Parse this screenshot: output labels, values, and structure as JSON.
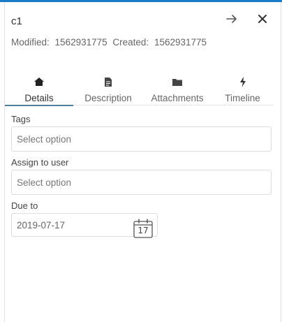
{
  "card": {
    "title": "c1",
    "modified_label": "Modified:",
    "modified_value": "1562931775",
    "created_label": "Created:",
    "created_value": "1562931775"
  },
  "header": {
    "icons": [
      "arrow-right-icon",
      "close-icon"
    ]
  },
  "tabs": [
    {
      "label": "Details",
      "icon": "home-icon",
      "active": true
    },
    {
      "label": "Description",
      "icon": "document-icon",
      "active": false
    },
    {
      "label": "Attachments",
      "icon": "folder-icon",
      "active": false
    },
    {
      "label": "Timeline",
      "icon": "lightning-icon",
      "active": false
    }
  ],
  "form": {
    "tags": {
      "label": "Tags",
      "placeholder": "Select option"
    },
    "assign": {
      "label": "Assign to user",
      "placeholder": "Select option"
    },
    "due": {
      "label": "Due to",
      "value": "2019-07-17",
      "calendar_day": "17"
    }
  },
  "colors": {
    "accent": "#1a7bc9",
    "tab_underline": "#4d7f9e"
  }
}
